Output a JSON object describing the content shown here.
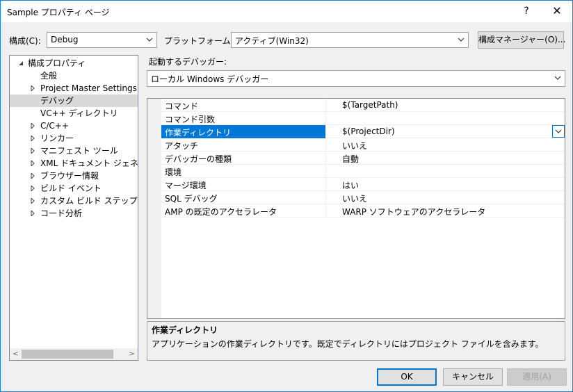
{
  "window": {
    "title": "Sample プロパティ ページ",
    "help_glyph": "?",
    "close_glyph": "✕"
  },
  "toolbar": {
    "config_label": "構成(C):",
    "config_value": "Debug",
    "platform_label": "プラットフォーム(P):",
    "platform_value": "アクティブ(Win32)",
    "config_manager_button": "構成マネージャー(O)..."
  },
  "tree": {
    "items": [
      {
        "label": "構成プロパティ",
        "expander": "expanded"
      },
      {
        "label": "全般",
        "expander": "none"
      },
      {
        "label": "Project Master Settings",
        "expander": "collapsed"
      },
      {
        "label": "デバッグ",
        "expander": "none",
        "selected": true
      },
      {
        "label": "VC++ ディレクトリ",
        "expander": "none"
      },
      {
        "label": "C/C++",
        "expander": "collapsed"
      },
      {
        "label": "リンカー",
        "expander": "collapsed"
      },
      {
        "label": "マニフェスト ツール",
        "expander": "collapsed"
      },
      {
        "label": "XML ドキュメント ジェネレーター",
        "expander": "collapsed"
      },
      {
        "label": "ブラウザー情報",
        "expander": "collapsed"
      },
      {
        "label": "ビルド イベント",
        "expander": "collapsed"
      },
      {
        "label": "カスタム ビルド ステップ",
        "expander": "collapsed"
      },
      {
        "label": "コード分析",
        "expander": "collapsed"
      }
    ]
  },
  "debugger": {
    "label": "起動するデバッガー:",
    "value": "ローカル Windows デバッガー"
  },
  "properties": [
    {
      "name": "コマンド",
      "value": "$(TargetPath)"
    },
    {
      "name": "コマンド引数",
      "value": ""
    },
    {
      "name": "作業ディレクトリ",
      "value": "$(ProjectDir)",
      "selected": true
    },
    {
      "name": "アタッチ",
      "value": "いいえ"
    },
    {
      "name": "デバッガーの種類",
      "value": "自動"
    },
    {
      "name": "環境",
      "value": ""
    },
    {
      "name": "マージ環境",
      "value": "はい"
    },
    {
      "name": "SQL デバッグ",
      "value": "いいえ"
    },
    {
      "name": "AMP の既定のアクセラレータ",
      "value": "WARP ソフトウェアのアクセラレータ"
    }
  ],
  "description": {
    "title": "作業ディレクトリ",
    "text": "アプリケーションの作業ディレクトリです。既定でディレクトリにはプロジェクト ファイルを含みます。"
  },
  "buttons": {
    "ok": "OK",
    "cancel": "キャンセル",
    "apply": "適用(A)"
  },
  "colors": {
    "accent": "#0078d7",
    "selection_gray": "#d9d9d9",
    "border": "#828790"
  }
}
